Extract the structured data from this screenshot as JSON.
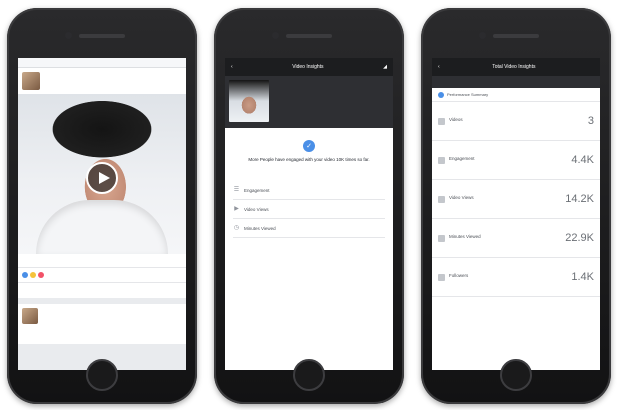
{
  "phone1": {
    "topbar": "",
    "post": {
      "name": "",
      "meta": ""
    },
    "insights_link": "",
    "reactions": {
      "left": "",
      "right": ""
    },
    "actions": [
      "",
      "",
      ""
    ],
    "post2": {
      "name": "",
      "meta": ""
    }
  },
  "phone2": {
    "nav": {
      "title": "Video Insights"
    },
    "video": {
      "title": "",
      "subtitle": ""
    },
    "top_note": "",
    "message": "More People have engaged with your video 10K times so far.",
    "rows": [
      {
        "label": "Engagement",
        "value": ""
      },
      {
        "label": "Video Views",
        "value": ""
      },
      {
        "label": "Minutes Viewed",
        "value": ""
      }
    ]
  },
  "phone3": {
    "nav": {
      "title": "Total Video Insights"
    },
    "tabs": [
      "",
      "",
      ""
    ],
    "section": "Performance Summary",
    "rows": [
      {
        "label": "Videos",
        "link": "",
        "value": "3"
      },
      {
        "label": "Engagement",
        "link": "",
        "value": "4.4K"
      },
      {
        "label": "Video Views",
        "link": "",
        "value": "14.2K"
      },
      {
        "label": "Minutes Viewed",
        "link": "",
        "value": "22.9K"
      },
      {
        "label": "Followers",
        "link": "",
        "value": "1.4K"
      }
    ]
  }
}
